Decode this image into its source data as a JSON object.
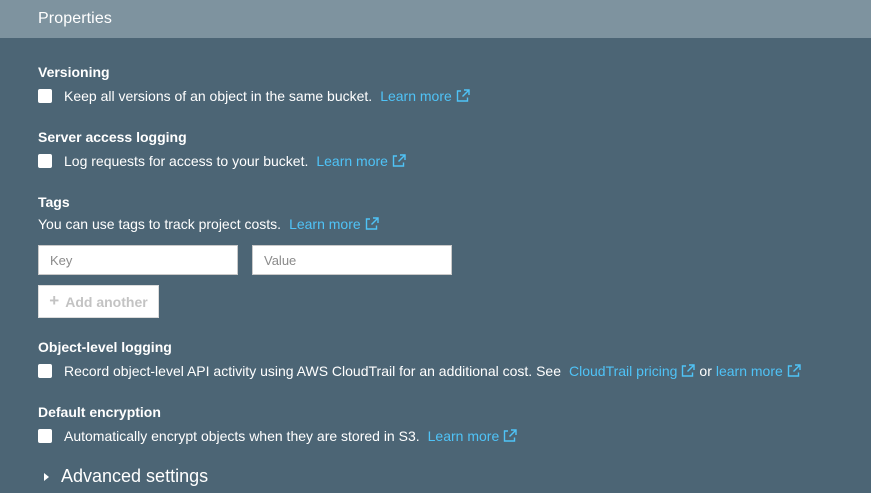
{
  "header": {
    "title": "Properties"
  },
  "versioning": {
    "title": "Versioning",
    "checkbox_text": "Keep all versions of an object in the same bucket.",
    "link": "Learn more",
    "link_icon": "external-link-icon"
  },
  "server_access_logging": {
    "title": "Server access logging",
    "checkbox_text": "Log requests for access to your bucket.",
    "link": "Learn more",
    "link_icon": "external-link-icon"
  },
  "tags": {
    "title": "Tags",
    "description": "You can use tags to track project costs.",
    "link": "Learn more",
    "link_icon": "external-link-icon",
    "key_placeholder": "Key",
    "value_placeholder": "Value",
    "add_button": "Add another"
  },
  "object_level_logging": {
    "title": "Object-level logging",
    "checkbox_text": "Record object-level API activity using AWS CloudTrail for an additional cost. See",
    "pricing_link": "CloudTrail pricing",
    "or_text": "or",
    "learn_link": "learn more"
  },
  "default_encryption": {
    "title": "Default encryption",
    "checkbox_text": "Automatically encrypt objects when they are stored in S3.",
    "link": "Learn more"
  },
  "advanced": {
    "label": "Advanced settings"
  },
  "colors": {
    "background": "#4c6575",
    "header": "#7e939f",
    "link": "#4fc3f7"
  }
}
